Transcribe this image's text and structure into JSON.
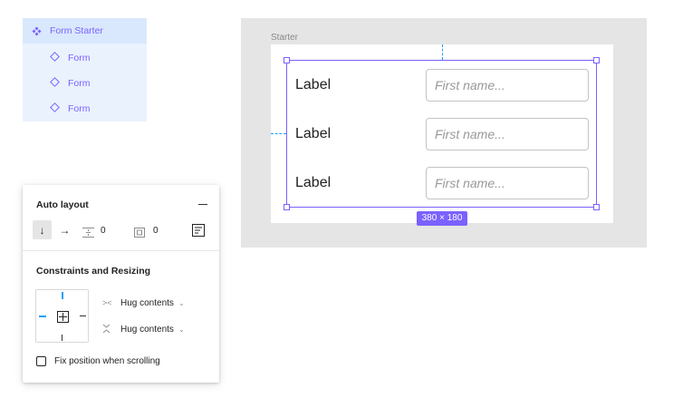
{
  "layers": {
    "items": [
      {
        "label": "Form Starter",
        "icon": "component-icon"
      },
      {
        "label": "Form",
        "icon": "instance-icon"
      },
      {
        "label": "Form",
        "icon": "instance-icon"
      },
      {
        "label": "Form",
        "icon": "instance-icon"
      }
    ]
  },
  "properties": {
    "auto_layout": {
      "title": "Auto layout",
      "spacing_value": "0",
      "padding_value": "0"
    },
    "constraints": {
      "title": "Constraints and Resizing",
      "horizontal": "Hug contents",
      "vertical": "Hug contents",
      "fix_position_label": "Fix position when scrolling"
    }
  },
  "canvas": {
    "frame_name": "Starter",
    "rows": [
      {
        "label": "Label",
        "placeholder": "First name..."
      },
      {
        "label": "Label",
        "placeholder": "First name..."
      },
      {
        "label": "Label",
        "placeholder": "First name..."
      }
    ],
    "dimensions": "380 × 180"
  },
  "colors": {
    "accent": "#7b61ff",
    "guide": "#18a0fb",
    "canvas_bg": "#e5e5e5",
    "layer_bg": "#eaf2fd"
  }
}
